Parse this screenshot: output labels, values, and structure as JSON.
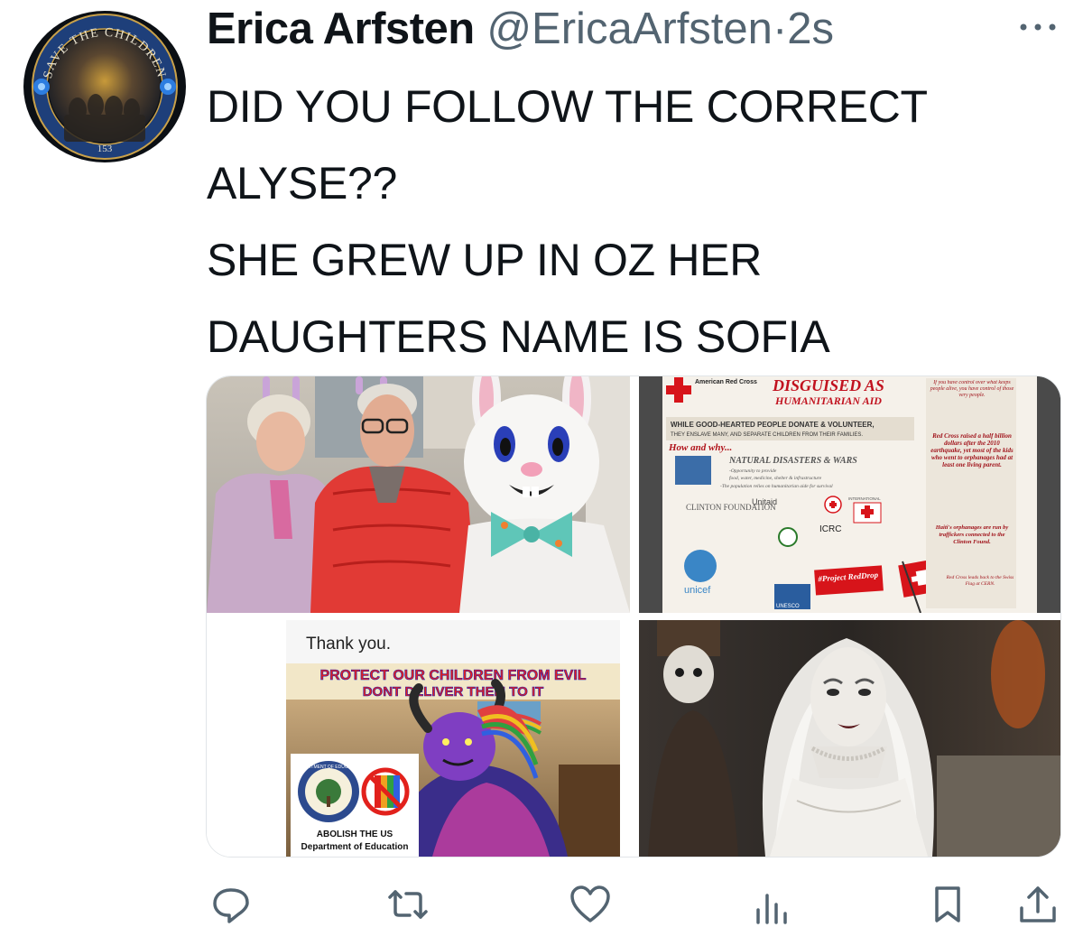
{
  "author": {
    "name": "Erica Arfsten",
    "handle": "@EricaArfsten",
    "separator": "·",
    "timestamp": "2s",
    "avatar_text": "SAVE THE CHILDREN",
    "avatar_number": "153"
  },
  "more_icon": "more-dots-icon",
  "tweet": {
    "lines": [
      "DID YOU FOLLOW THE CORRECT",
      "ALYSE??",
      "SHE GREW UP IN OZ HER",
      "DAUGHTERS NAME IS SOFIA"
    ]
  },
  "media": {
    "image2": {
      "header_org": "American Red Cross",
      "title": "DISGUISED AS",
      "subtitle": "HUMANITARIAN AID",
      "banner": "WHILE GOOD-HEARTED PEOPLE DONATE & VOLUNTEER,",
      "banner2": "THEY ENSLAVE MANY, AND SEPARATE CHILDREN FROM THEIR FAMILIES.",
      "how": "How and why...",
      "disasters": "NATURAL DISASTERS & WARS",
      "note1": "-Opportunity to provide",
      "note2": "food, water, medicine, shelter & infrastructure",
      "note3": "-The population relies on humanitarian aide for survival",
      "org_unitaid": "Unitaid",
      "org_clinton": "CLINTON FOUNDATION",
      "org_icrc": "ICRC",
      "org_intl": "INTERNATIONAL",
      "org_unicef": "unicef",
      "org_unesco": "UNESCO",
      "tag": "#Project RedDrop",
      "side1": "If you have control over what keeps people alive, you have control of those very people.",
      "side2": "Red Cross raised a half billion dollars after the 2010 earthquake, yet most of the kids who went to orphanages had at least one living parent.",
      "side3": "Haiti's orphanages are run by traffickers connected to the Clinton Found.",
      "side4": "Red Cross leads back to the Swiss Flag at CERN."
    },
    "image3": {
      "thanks": "Thank you.",
      "line1": "PROTECT OUR CHILDREN FROM EVIL",
      "line2": "DONT DELIVER THEM TO IT",
      "badge_line1": "ABOLISH THE US",
      "badge_line2": "Department of Education",
      "seal_text": "DEPARTMENT OF EDUCATION"
    }
  },
  "actions": [
    {
      "name": "reply",
      "icon": "reply-icon"
    },
    {
      "name": "retweet",
      "icon": "retweet-icon"
    },
    {
      "name": "like",
      "icon": "like-icon"
    },
    {
      "name": "views",
      "icon": "views-icon"
    },
    {
      "name": "bookmark",
      "icon": "bookmark-icon"
    },
    {
      "name": "share",
      "icon": "share-icon"
    }
  ],
  "colors": {
    "text": "#0f1419",
    "secondary": "#536471",
    "red_cross": "#d7141a",
    "evil_banner": "#e2211c",
    "evil_text": "#1c1cbf"
  }
}
